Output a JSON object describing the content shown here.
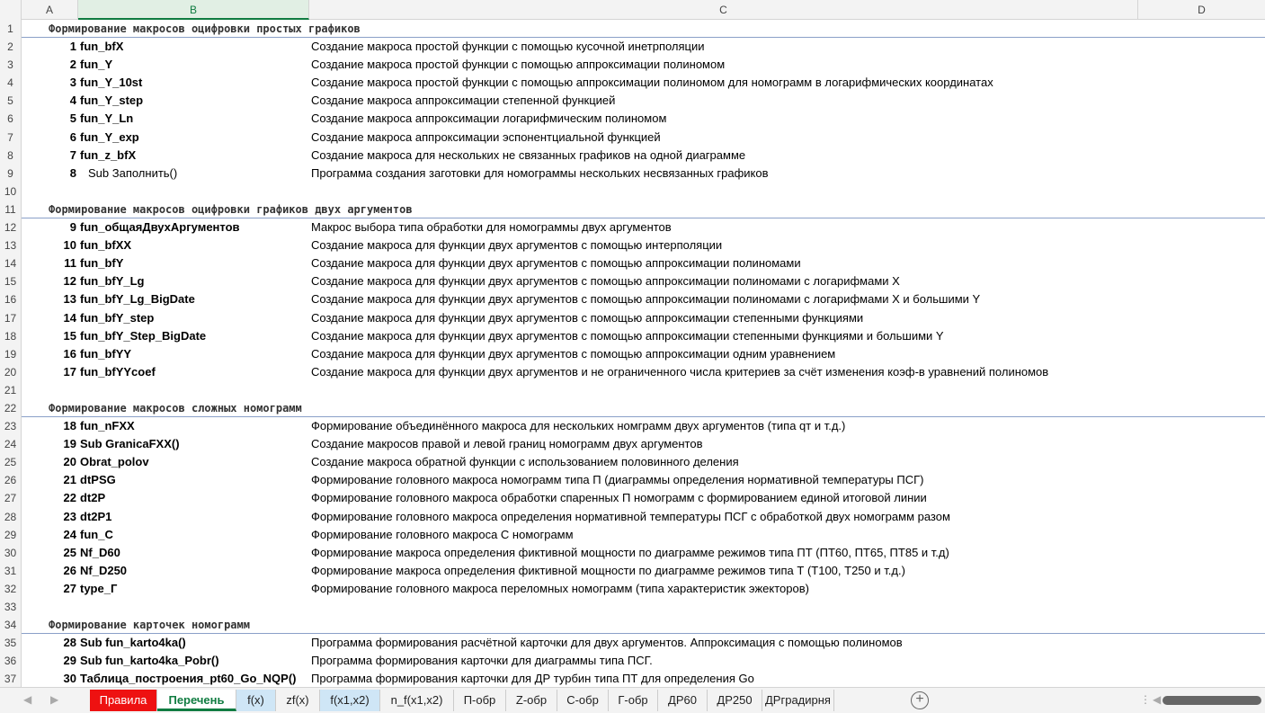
{
  "columns": [
    "A",
    "B",
    "C",
    "D"
  ],
  "rows": [
    {
      "type": "header",
      "text": "Формирование макросов оцифровки простых графиков"
    },
    {
      "num": "1",
      "name": "fun_bfX",
      "desc": "Создание макроса простой функции с помощью кусочной инетрполяции"
    },
    {
      "num": "2",
      "name": "fun_Y",
      "desc": "Создание макроса простой функции с помощью аппроксимации полиномом"
    },
    {
      "num": "3",
      "name": "fun_Y_10st",
      "desc": "Создание макроса простой функции с помощью аппроксимации полиномом для номограмм в логарифмических координатах"
    },
    {
      "num": "4",
      "name": "fun_Y_step",
      "desc": "Создание макроса  аппроксимации степенной функцией"
    },
    {
      "num": "5",
      "name": "fun_Y_Ln",
      "desc": "Создание макроса  аппроксимации логарифмическим полиномом"
    },
    {
      "num": "6",
      "name": "fun_Y_exp",
      "desc": "Создание макроса  аппроксимации эспонентциальной функцией"
    },
    {
      "num": "7",
      "name": "fun_z_bfX",
      "desc": "Создание макроса  для нескольких не связанных графиков на одной диаграмме"
    },
    {
      "num": "8",
      "name": "Sub Заполнить()",
      "desc": "Программа создания заготовки для номограммы нескольких несвязанных графиков",
      "plain": true
    },
    {
      "type": "empty"
    },
    {
      "type": "header",
      "text": "Формирование макросов оцифровки графиков двух аргументов"
    },
    {
      "num": "9",
      "name": "fun_общаяДвухАргументов",
      "desc": "Макрос выбора типа обработки для номограммы двух аргументов"
    },
    {
      "num": "10",
      "name": "fun_bfXX",
      "desc": "Создание макроса для функции двух аргументов с помощью интерполяции"
    },
    {
      "num": "11",
      "name": "fun_bfY",
      "desc": "Создание макроса для функции двух аргументов с помощью аппроксимации полиномами"
    },
    {
      "num": "12",
      "name": "fun_bfY_Lg",
      "desc": "Создание макроса для функции двух аргументов с помощью аппроксимации полиномами с логарифмами X"
    },
    {
      "num": "13",
      "name": "fun_bfY_Lg_BigDate",
      "desc": "Создание макроса для функции двух аргументов с помощью аппроксимации полиномами с логарифмами X и большими Y"
    },
    {
      "num": "14",
      "name": "fun_bfY_step",
      "desc": "Создание макроса для функции двух аргументов с помощью аппроксимации степенными функциями"
    },
    {
      "num": "15",
      "name": "fun_bfY_Step_BigDate",
      "desc": "Создание макроса для функции двух аргументов с помощью аппроксимации степенными функциями и большими Y"
    },
    {
      "num": "16",
      "name": "fun_bfYY",
      "desc": "Создание макроса для функции двух аргументов с помощью аппроксимации одним уравнением"
    },
    {
      "num": "17",
      "name": "fun_bfYYcoef",
      "desc": "Создание макроса для функции двух аргументов и не ограниченного числа критериев за счёт изменения коэф-в уравнений полиномов"
    },
    {
      "type": "empty"
    },
    {
      "type": "header",
      "text": "Формирование макросов сложных номограмм"
    },
    {
      "num": "18",
      "name": "fun_nFXX",
      "desc": "Формирование объединённого макроса для нескольких номграмм двух аргументов (типа qт и т.д.)"
    },
    {
      "num": "19",
      "name": "Sub GranicaFXX()",
      "desc": "Создание макросов правой и левой границ номограмм двух аргументов"
    },
    {
      "num": "20",
      "name": "Obrat_polov",
      "desc": "Создание макроса  обратной функции с использованием половинного деления"
    },
    {
      "num": "21",
      "name": "dtPSG",
      "desc": "Формирование головного макроса номограмм типа П (диаграммы определения нормативной температуры ПСГ)"
    },
    {
      "num": "22",
      "name": "dt2P",
      "desc": "Формирование головного макроса обработки спаренных П номограмм с формированием единой итоговой линии"
    },
    {
      "num": "23",
      "name": "dt2P1",
      "desc": "Формирование головного макроса определения нормативной температуры ПСГ с обработкой двух номограмм разом"
    },
    {
      "num": "24",
      "name": "fun_C",
      "desc": "Формирование головного макроса С номограмм"
    },
    {
      "num": "25",
      "name": "Nf_D60",
      "desc": "Формирование макроса определения фиктивной мощности по диаграмме режимов типа ПТ (ПТ60, ПТ65, ПТ85 и т.д)"
    },
    {
      "num": "26",
      "name": "Nf_D250",
      "desc": "Формирование макроса определения фиктивной мощности по диаграмме режимов типа Т (Т100, Т250 и т.д.)"
    },
    {
      "num": "27",
      "name": "type_Г",
      "desc": "Формирование головного макроса переломных номограмм (типа характеристик эжекторов)"
    },
    {
      "type": "empty"
    },
    {
      "type": "header",
      "text": "Формирование карточек номограмм"
    },
    {
      "num": "28",
      "name": "Sub fun_karto4ka()",
      "desc": "Программа формирования расчётной карточки для двух аргументов. Аппроксимация с помощью полиномов"
    },
    {
      "num": "29",
      "name": "Sub fun_karto4ka_Pobr()",
      "desc": "Программа формирования карточки для диаграммы типа ПСГ."
    },
    {
      "num": "30",
      "name": "Таблица_построения_pt60_Go_NQP()",
      "desc": "Программа формирования карточки для ДР турбин типа ПТ для определения Go"
    }
  ],
  "tabs": [
    {
      "label": "Правила",
      "style": "red"
    },
    {
      "label": "Перечень",
      "style": "active"
    },
    {
      "label": "f(x)",
      "style": "blue"
    },
    {
      "label": "zf(x)",
      "style": ""
    },
    {
      "label": "f(x1,x2)",
      "style": "blue"
    },
    {
      "label": "n_f(x1,x2)",
      "style": ""
    },
    {
      "label": "П-обр",
      "style": ""
    },
    {
      "label": "Z-обр",
      "style": ""
    },
    {
      "label": "С-обр",
      "style": ""
    },
    {
      "label": "Г-обр",
      "style": ""
    },
    {
      "label": "ДР60",
      "style": ""
    },
    {
      "label": "ДР250",
      "style": ""
    },
    {
      "label": "ДРградирня",
      "style": ""
    }
  ],
  "add_sheet_label": "+",
  "colors": {
    "active_tab": "#107c41",
    "rules_tab": "#ee1111",
    "header_rule": "#8aa0c8"
  }
}
